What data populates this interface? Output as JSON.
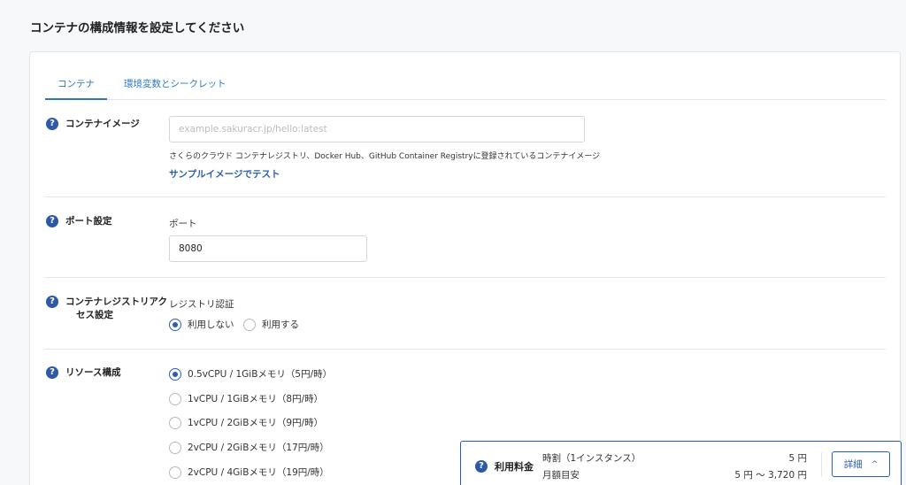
{
  "page_title": "コンテナの構成情報を設定してください",
  "tabs": [
    {
      "label": "コンテナ",
      "active": true
    },
    {
      "label": "環境変数とシークレット",
      "active": false
    }
  ],
  "help_glyph": "?",
  "container_image": {
    "label": "コンテナイメージ",
    "placeholder": "example.sakuracr.jp/hello:latest",
    "value": "",
    "description": "さくらのクラウド コンテナレジストリ、Docker Hub、GitHub Container Registryに登録されているコンテナイメージ",
    "sample_link": "サンプルイメージでテスト"
  },
  "port": {
    "label": "ポート設定",
    "field_label": "ポート",
    "value": "8080"
  },
  "registry_access": {
    "label_line1": "コンテナレジストリアク",
    "label_line2": "セス設定",
    "field_label": "レジストリ認証",
    "options": [
      {
        "label": "利用しない",
        "checked": true
      },
      {
        "label": "利用する",
        "checked": false
      }
    ]
  },
  "resources": {
    "label": "リソース構成",
    "options": [
      {
        "label": "0.5vCPU / 1GiBメモリ（5円/時）",
        "checked": true
      },
      {
        "label": "1vCPU / 1GiBメモリ（8円/時）",
        "checked": false
      },
      {
        "label": "1vCPU / 2GiBメモリ（9円/時）",
        "checked": false
      },
      {
        "label": "2vCPU / 2GiBメモリ（17円/時）",
        "checked": false
      },
      {
        "label": "2vCPU / 4GiBメモリ（19円/時）",
        "checked": false
      }
    ]
  },
  "pricing": {
    "title": "利用料金",
    "hourly_label": "時割（1インスタンス）",
    "hourly_value": "5 円",
    "monthly_label": "月額目安",
    "monthly_value": "5 円 ～ 3,720 円",
    "detail_button": "詳細",
    "detail_chevron": "^"
  },
  "colors": {
    "accent": "#2a5eb3",
    "tab_active": "#2a78c5",
    "help_icon": "#2d5aa8",
    "border": "#e4e6ea"
  }
}
